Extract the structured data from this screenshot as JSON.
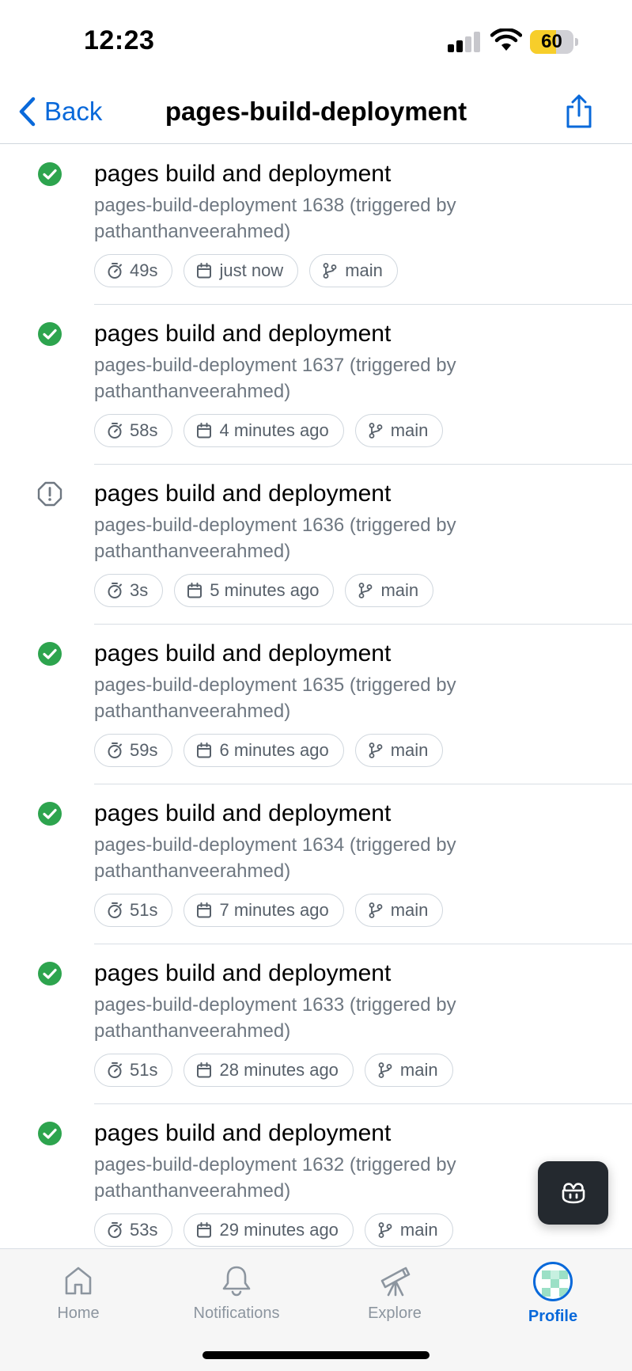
{
  "status_bar": {
    "time": "12:23",
    "battery": "60",
    "battery_level": 0.6
  },
  "nav": {
    "back_label": "Back",
    "title": "pages-build-deployment"
  },
  "runs": [
    {
      "status": "success",
      "title": "pages build and deployment",
      "subtitle": "pages-build-deployment 1638 (triggered by pathanthanveerahmed)",
      "duration": "49s",
      "time": "just now",
      "branch": "main"
    },
    {
      "status": "success",
      "title": "pages build and deployment",
      "subtitle": "pages-build-deployment 1637 (triggered by pathanthanveerahmed)",
      "duration": "58s",
      "time": "4 minutes ago",
      "branch": "main"
    },
    {
      "status": "warning",
      "title": "pages build and deployment",
      "subtitle": "pages-build-deployment 1636 (triggered by pathanthanveerahmed)",
      "duration": "3s",
      "time": "5 minutes ago",
      "branch": "main"
    },
    {
      "status": "success",
      "title": "pages build and deployment",
      "subtitle": "pages-build-deployment 1635 (triggered by pathanthanveerahmed)",
      "duration": "59s",
      "time": "6 minutes ago",
      "branch": "main"
    },
    {
      "status": "success",
      "title": "pages build and deployment",
      "subtitle": "pages-build-deployment 1634 (triggered by pathanthanveerahmed)",
      "duration": "51s",
      "time": "7 minutes ago",
      "branch": "main"
    },
    {
      "status": "success",
      "title": "pages build and deployment",
      "subtitle": "pages-build-deployment 1633 (triggered by pathanthanveerahmed)",
      "duration": "51s",
      "time": "28 minutes ago",
      "branch": "main"
    },
    {
      "status": "success",
      "title": "pages build and deployment",
      "subtitle": "pages-build-deployment 1632 (triggered by pathanthanveerahmed)",
      "duration": "53s",
      "time": "29 minutes ago",
      "branch": "main"
    }
  ],
  "tabs": [
    {
      "label": "Home",
      "icon": "home-icon",
      "active": false
    },
    {
      "label": "Notifications",
      "icon": "bell-icon",
      "active": false
    },
    {
      "label": "Explore",
      "icon": "telescope-icon",
      "active": false
    },
    {
      "label": "Profile",
      "icon": "avatar",
      "active": true
    }
  ],
  "colors": {
    "accent": "#0969da",
    "success": "#2da44e",
    "muted": "#6e7781"
  }
}
